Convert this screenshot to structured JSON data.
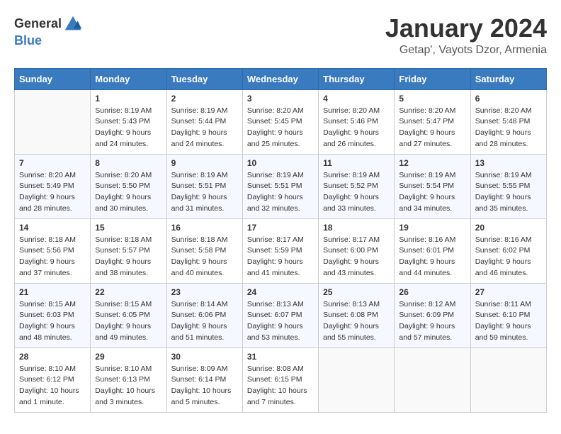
{
  "logo": {
    "general": "General",
    "blue": "Blue"
  },
  "title": "January 2024",
  "location": "Getap', Vayots Dzor, Armenia",
  "weekdays": [
    "Sunday",
    "Monday",
    "Tuesday",
    "Wednesday",
    "Thursday",
    "Friday",
    "Saturday"
  ],
  "weeks": [
    [
      {
        "day": "",
        "sunrise": "",
        "sunset": "",
        "daylight": ""
      },
      {
        "day": "1",
        "sunrise": "Sunrise: 8:19 AM",
        "sunset": "Sunset: 5:43 PM",
        "daylight": "Daylight: 9 hours and 24 minutes."
      },
      {
        "day": "2",
        "sunrise": "Sunrise: 8:19 AM",
        "sunset": "Sunset: 5:44 PM",
        "daylight": "Daylight: 9 hours and 24 minutes."
      },
      {
        "day": "3",
        "sunrise": "Sunrise: 8:20 AM",
        "sunset": "Sunset: 5:45 PM",
        "daylight": "Daylight: 9 hours and 25 minutes."
      },
      {
        "day": "4",
        "sunrise": "Sunrise: 8:20 AM",
        "sunset": "Sunset: 5:46 PM",
        "daylight": "Daylight: 9 hours and 26 minutes."
      },
      {
        "day": "5",
        "sunrise": "Sunrise: 8:20 AM",
        "sunset": "Sunset: 5:47 PM",
        "daylight": "Daylight: 9 hours and 27 minutes."
      },
      {
        "day": "6",
        "sunrise": "Sunrise: 8:20 AM",
        "sunset": "Sunset: 5:48 PM",
        "daylight": "Daylight: 9 hours and 28 minutes."
      }
    ],
    [
      {
        "day": "7",
        "sunrise": "Sunrise: 8:20 AM",
        "sunset": "Sunset: 5:49 PM",
        "daylight": "Daylight: 9 hours and 28 minutes."
      },
      {
        "day": "8",
        "sunrise": "Sunrise: 8:20 AM",
        "sunset": "Sunset: 5:50 PM",
        "daylight": "Daylight: 9 hours and 30 minutes."
      },
      {
        "day": "9",
        "sunrise": "Sunrise: 8:19 AM",
        "sunset": "Sunset: 5:51 PM",
        "daylight": "Daylight: 9 hours and 31 minutes."
      },
      {
        "day": "10",
        "sunrise": "Sunrise: 8:19 AM",
        "sunset": "Sunset: 5:51 PM",
        "daylight": "Daylight: 9 hours and 32 minutes."
      },
      {
        "day": "11",
        "sunrise": "Sunrise: 8:19 AM",
        "sunset": "Sunset: 5:52 PM",
        "daylight": "Daylight: 9 hours and 33 minutes."
      },
      {
        "day": "12",
        "sunrise": "Sunrise: 8:19 AM",
        "sunset": "Sunset: 5:54 PM",
        "daylight": "Daylight: 9 hours and 34 minutes."
      },
      {
        "day": "13",
        "sunrise": "Sunrise: 8:19 AM",
        "sunset": "Sunset: 5:55 PM",
        "daylight": "Daylight: 9 hours and 35 minutes."
      }
    ],
    [
      {
        "day": "14",
        "sunrise": "Sunrise: 8:18 AM",
        "sunset": "Sunset: 5:56 PM",
        "daylight": "Daylight: 9 hours and 37 minutes."
      },
      {
        "day": "15",
        "sunrise": "Sunrise: 8:18 AM",
        "sunset": "Sunset: 5:57 PM",
        "daylight": "Daylight: 9 hours and 38 minutes."
      },
      {
        "day": "16",
        "sunrise": "Sunrise: 8:18 AM",
        "sunset": "Sunset: 5:58 PM",
        "daylight": "Daylight: 9 hours and 40 minutes."
      },
      {
        "day": "17",
        "sunrise": "Sunrise: 8:17 AM",
        "sunset": "Sunset: 5:59 PM",
        "daylight": "Daylight: 9 hours and 41 minutes."
      },
      {
        "day": "18",
        "sunrise": "Sunrise: 8:17 AM",
        "sunset": "Sunset: 6:00 PM",
        "daylight": "Daylight: 9 hours and 43 minutes."
      },
      {
        "day": "19",
        "sunrise": "Sunrise: 8:16 AM",
        "sunset": "Sunset: 6:01 PM",
        "daylight": "Daylight: 9 hours and 44 minutes."
      },
      {
        "day": "20",
        "sunrise": "Sunrise: 8:16 AM",
        "sunset": "Sunset: 6:02 PM",
        "daylight": "Daylight: 9 hours and 46 minutes."
      }
    ],
    [
      {
        "day": "21",
        "sunrise": "Sunrise: 8:15 AM",
        "sunset": "Sunset: 6:03 PM",
        "daylight": "Daylight: 9 hours and 48 minutes."
      },
      {
        "day": "22",
        "sunrise": "Sunrise: 8:15 AM",
        "sunset": "Sunset: 6:05 PM",
        "daylight": "Daylight: 9 hours and 49 minutes."
      },
      {
        "day": "23",
        "sunrise": "Sunrise: 8:14 AM",
        "sunset": "Sunset: 6:06 PM",
        "daylight": "Daylight: 9 hours and 51 minutes."
      },
      {
        "day": "24",
        "sunrise": "Sunrise: 8:13 AM",
        "sunset": "Sunset: 6:07 PM",
        "daylight": "Daylight: 9 hours and 53 minutes."
      },
      {
        "day": "25",
        "sunrise": "Sunrise: 8:13 AM",
        "sunset": "Sunset: 6:08 PM",
        "daylight": "Daylight: 9 hours and 55 minutes."
      },
      {
        "day": "26",
        "sunrise": "Sunrise: 8:12 AM",
        "sunset": "Sunset: 6:09 PM",
        "daylight": "Daylight: 9 hours and 57 minutes."
      },
      {
        "day": "27",
        "sunrise": "Sunrise: 8:11 AM",
        "sunset": "Sunset: 6:10 PM",
        "daylight": "Daylight: 9 hours and 59 minutes."
      }
    ],
    [
      {
        "day": "28",
        "sunrise": "Sunrise: 8:10 AM",
        "sunset": "Sunset: 6:12 PM",
        "daylight": "Daylight: 10 hours and 1 minute."
      },
      {
        "day": "29",
        "sunrise": "Sunrise: 8:10 AM",
        "sunset": "Sunset: 6:13 PM",
        "daylight": "Daylight: 10 hours and 3 minutes."
      },
      {
        "day": "30",
        "sunrise": "Sunrise: 8:09 AM",
        "sunset": "Sunset: 6:14 PM",
        "daylight": "Daylight: 10 hours and 5 minutes."
      },
      {
        "day": "31",
        "sunrise": "Sunrise: 8:08 AM",
        "sunset": "Sunset: 6:15 PM",
        "daylight": "Daylight: 10 hours and 7 minutes."
      },
      {
        "day": "",
        "sunrise": "",
        "sunset": "",
        "daylight": ""
      },
      {
        "day": "",
        "sunrise": "",
        "sunset": "",
        "daylight": ""
      },
      {
        "day": "",
        "sunrise": "",
        "sunset": "",
        "daylight": ""
      }
    ]
  ]
}
